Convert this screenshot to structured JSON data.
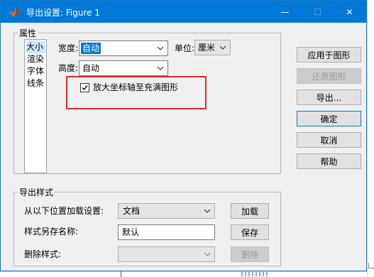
{
  "window": {
    "title": "导出设置: Figure 1",
    "app_icon": "matlab-icon",
    "controls": {
      "minimize": "—",
      "maximize": "☐",
      "close": "✕"
    }
  },
  "properties": {
    "group_label": "属性",
    "categories": [
      {
        "label": "大小",
        "selected": true
      },
      {
        "label": "渲染",
        "selected": false
      },
      {
        "label": "字体",
        "selected": false
      },
      {
        "label": "线条",
        "selected": false
      }
    ],
    "width": {
      "label": "宽度:",
      "value": "自动"
    },
    "units": {
      "label": "单位:",
      "value": "厘米"
    },
    "height": {
      "label": "高度:",
      "value": "自动"
    },
    "expand_axes": {
      "label": "放大坐标轴至充满图形",
      "checked": true
    }
  },
  "actions": {
    "apply": "应用于图形",
    "restore": "还原图形",
    "export": "导出...",
    "ok": "确定",
    "cancel": "取消",
    "help": "帮助"
  },
  "export_styles": {
    "group_label": "导出样式",
    "load": {
      "label": "从以下位置加载设置:",
      "value": "文档",
      "button": "加载"
    },
    "save": {
      "label": "样式另存名称:",
      "value": "默认",
      "button": "保存"
    },
    "delete": {
      "label": "删除样式:",
      "value": "",
      "button": "删除"
    }
  },
  "colors": {
    "titlebar": "#0078d7",
    "selection": "#0078d7",
    "annotation_box": "#e0292b"
  }
}
